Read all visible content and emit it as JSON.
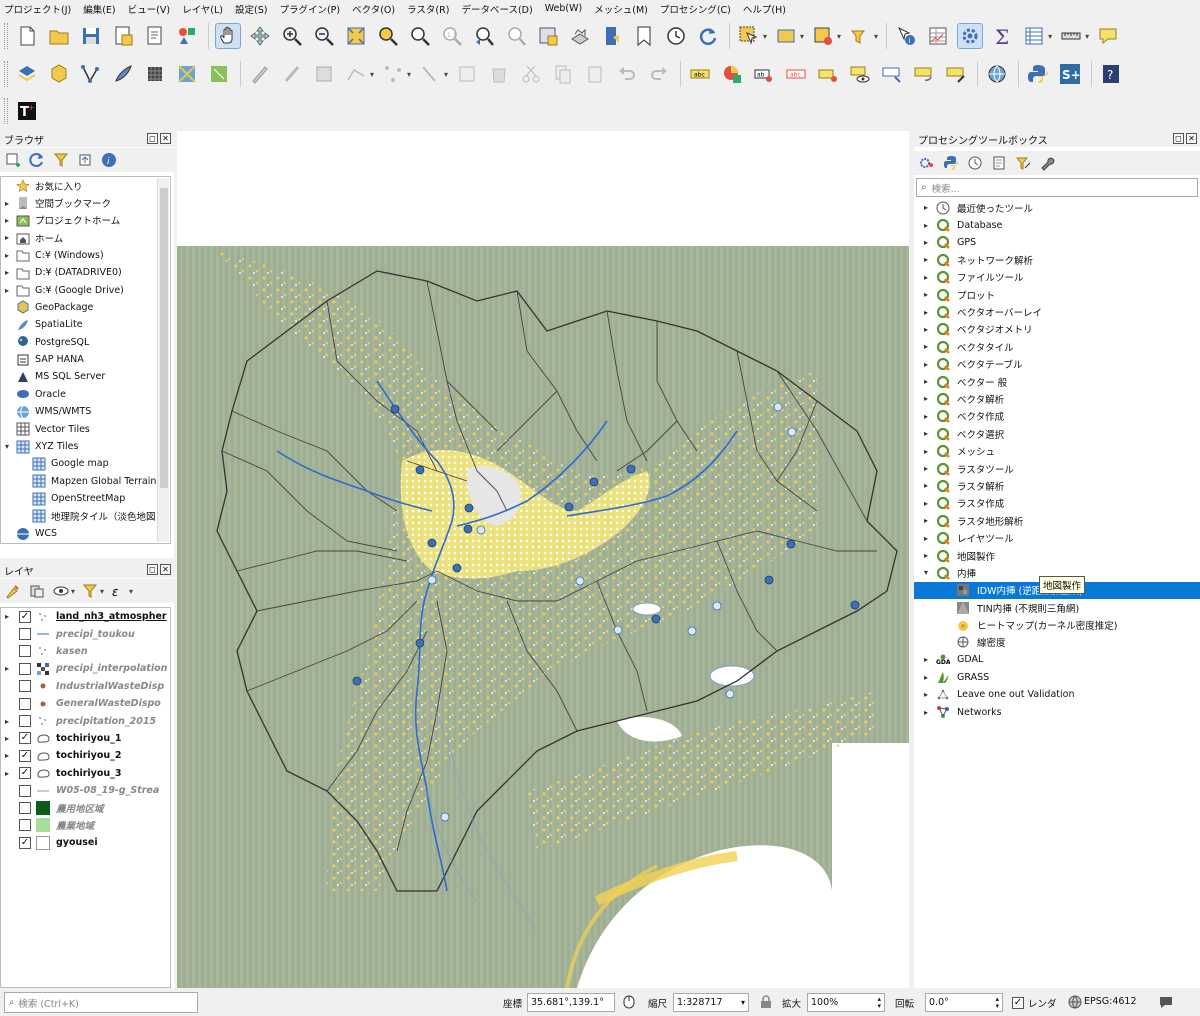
{
  "menu": [
    "プロジェクト(J)",
    "編集(E)",
    "ビュー(V)",
    "レイヤ(L)",
    "設定(S)",
    "プラグイン(P)",
    "ベクタ(O)",
    "ラスタ(R)",
    "データベース(D)",
    "Web(W)",
    "メッシュ(M)",
    "プロセシング(C)",
    "ヘルプ(H)"
  ],
  "browser": {
    "title": "ブラウザ",
    "items": [
      {
        "label": "お気に入り",
        "icon": "star-icon",
        "expand": false
      },
      {
        "label": "空間ブックマーク",
        "icon": "bookmark-icon",
        "expand": true
      },
      {
        "label": "プロジェクトホーム",
        "icon": "project-home-icon",
        "expand": true
      },
      {
        "label": "ホーム",
        "icon": "home-folder-icon",
        "expand": true
      },
      {
        "label": "C:¥ (Windows)",
        "icon": "folder-icon",
        "expand": true
      },
      {
        "label": "D:¥ (DATADRIVE0)",
        "icon": "folder-icon",
        "expand": true
      },
      {
        "label": "G:¥ (Google Drive)",
        "icon": "folder-icon",
        "expand": true
      },
      {
        "label": "GeoPackage",
        "icon": "geopackage-icon",
        "expand": false
      },
      {
        "label": "SpatiaLite",
        "icon": "spatialite-icon",
        "expand": false
      },
      {
        "label": "PostgreSQL",
        "icon": "postgresql-icon",
        "expand": false
      },
      {
        "label": "SAP HANA",
        "icon": "sap-hana-icon",
        "expand": false
      },
      {
        "label": "MS SQL Server",
        "icon": "mssql-icon",
        "expand": false
      },
      {
        "label": "Oracle",
        "icon": "oracle-icon",
        "expand": false
      },
      {
        "label": "WMS/WMTS",
        "icon": "wms-icon",
        "expand": false
      },
      {
        "label": "Vector Tiles",
        "icon": "vector-tiles-icon",
        "expand": false
      },
      {
        "label": "XYZ Tiles",
        "icon": "xyz-tiles-icon",
        "expand": "open"
      },
      {
        "label": "Google map",
        "icon": "tile-grid-icon",
        "child": true
      },
      {
        "label": "Mapzen Global Terrain",
        "icon": "tile-grid-icon",
        "child": true
      },
      {
        "label": "OpenStreetMap",
        "icon": "tile-grid-icon",
        "child": true
      },
      {
        "label": "地理院タイル（淡色地図",
        "icon": "tile-grid-icon",
        "child": true
      },
      {
        "label": "WCS",
        "icon": "wcs-icon",
        "expand": false
      }
    ]
  },
  "layers": {
    "title": "レイヤ",
    "items": [
      {
        "label": "land_nh3_atmospher",
        "checked": true,
        "on": true,
        "expand": true,
        "icon": "point-layer-icon",
        "style": "plain"
      },
      {
        "label": "precipi_toukou",
        "checked": false,
        "on": false,
        "icon": "line-layer-icon"
      },
      {
        "label": "kasen",
        "checked": false,
        "on": false,
        "icon": "point-layer-icon"
      },
      {
        "label": "precipi_interpolation",
        "checked": false,
        "on": false,
        "expand": true,
        "icon": "raster-layer-icon"
      },
      {
        "label": "IndustrialWasteDisp",
        "checked": false,
        "on": false,
        "icon": "brown-point-icon"
      },
      {
        "label": "GeneralWasteDispo",
        "checked": false,
        "on": false,
        "icon": "brown-point-icon"
      },
      {
        "label": "precipitation_2015",
        "checked": false,
        "on": false,
        "expand": true,
        "icon": "point-layer-icon"
      },
      {
        "label": "tochiriyou_1",
        "checked": true,
        "on": true,
        "expand": true,
        "icon": "polygon-layer-icon"
      },
      {
        "label": "tochiriyou_2",
        "checked": true,
        "on": true,
        "expand": true,
        "icon": "polygon-layer-icon"
      },
      {
        "label": "tochiriyou_3",
        "checked": true,
        "on": true,
        "expand": true,
        "icon": "polygon-layer-icon"
      },
      {
        "label": "W05-08_19-g_Strea",
        "checked": false,
        "on": false,
        "icon": "stream-line-icon"
      },
      {
        "label": "農用地区域",
        "checked": false,
        "on": false,
        "icon": "dark-green-fill-icon"
      },
      {
        "label": "農業地域",
        "checked": false,
        "on": false,
        "icon": "light-green-fill-icon"
      },
      {
        "label": "gyousei",
        "checked": true,
        "on": true,
        "icon": "white-fill-icon"
      }
    ]
  },
  "toolbox": {
    "title": "プロセシングツールボックス",
    "search_placeholder": "検索...",
    "items": [
      {
        "label": "最近使ったツール",
        "icon": "clock-icon"
      },
      {
        "label": "Database",
        "icon": "qgis-q-icon"
      },
      {
        "label": "GPS",
        "icon": "qgis-q-icon"
      },
      {
        "label": "ネットワーク解析",
        "icon": "qgis-q-icon"
      },
      {
        "label": "ファイルツール",
        "icon": "qgis-q-icon"
      },
      {
        "label": "プロット",
        "icon": "qgis-q-icon"
      },
      {
        "label": "ベクタオーバーレイ",
        "icon": "qgis-q-icon"
      },
      {
        "label": "ベクタジオメトリ",
        "icon": "qgis-q-icon"
      },
      {
        "label": "ベクタタイル",
        "icon": "qgis-q-icon"
      },
      {
        "label": "ベクタテーブル",
        "icon": "qgis-q-icon"
      },
      {
        "label": "ベクター 般",
        "icon": "qgis-q-icon"
      },
      {
        "label": "ベクタ解析",
        "icon": "qgis-q-icon"
      },
      {
        "label": "ベクタ作成",
        "icon": "qgis-q-icon"
      },
      {
        "label": "ベクタ選択",
        "icon": "qgis-q-icon"
      },
      {
        "label": "メッシュ",
        "icon": "qgis-q-icon"
      },
      {
        "label": "ラスタツール",
        "icon": "qgis-q-icon"
      },
      {
        "label": "ラスタ解析",
        "icon": "qgis-q-icon"
      },
      {
        "label": "ラスタ作成",
        "icon": "qgis-q-icon"
      },
      {
        "label": "ラスタ地形解析",
        "icon": "qgis-q-icon"
      },
      {
        "label": "レイヤツール",
        "icon": "qgis-q-icon"
      },
      {
        "label": "地図製作",
        "icon": "qgis-q-icon"
      },
      {
        "label": "内挿",
        "icon": "qgis-q-icon",
        "open": true
      },
      {
        "label": "IDW内挿 (逆距離加重法)",
        "icon": "idw-icon",
        "child": true,
        "selected": true
      },
      {
        "label": "TIN内挿 (不規則三角網)",
        "icon": "tin-icon",
        "child": true
      },
      {
        "label": "ヒートマップ(カーネル密度推定)",
        "icon": "heatmap-icon",
        "child": true
      },
      {
        "label": "線密度",
        "icon": "line-density-icon",
        "child": true
      },
      {
        "label": "GDAL",
        "icon": "gdal-icon"
      },
      {
        "label": "GRASS",
        "icon": "grass-icon"
      },
      {
        "label": "Leave one out Validation",
        "icon": "loo-icon"
      },
      {
        "label": "Networks",
        "icon": "networks-icon"
      }
    ],
    "tooltip": "地図製作"
  },
  "status": {
    "search_placeholder": "検索 (Ctrl+K)",
    "coord_label": "座標",
    "coord_value": "35.681°,139.1°",
    "scale_label": "縮尺",
    "scale_value": "1:328717",
    "magnifier_label": "拡大",
    "magnifier_value": "100%",
    "rotation_label": "回転",
    "rotation_value": "0.0°",
    "render_label": "レンダ",
    "crs": "EPSG:4612"
  }
}
